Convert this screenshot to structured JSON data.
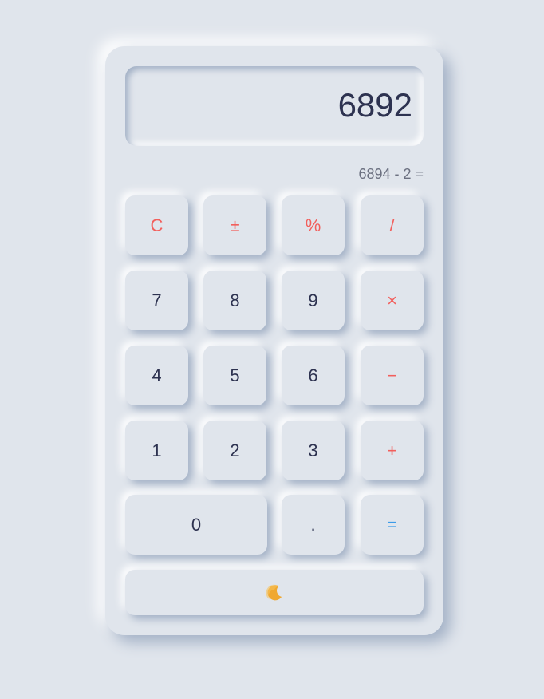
{
  "display": {
    "value": "6892",
    "expression": "6894 - 2 ="
  },
  "keys": {
    "clear": "C",
    "sign": "±",
    "percent": "%",
    "divide": "/",
    "seven": "7",
    "eight": "8",
    "nine": "9",
    "multiply": "×",
    "four": "4",
    "five": "5",
    "six": "6",
    "subtract": "−",
    "one": "1",
    "two": "2",
    "three": "3",
    "add": "+",
    "zero": "0",
    "decimal": ".",
    "equals": "="
  },
  "theme_toggle": {
    "icon": "moon-icon"
  },
  "colors": {
    "background": "#e0e5ec",
    "text": "#2d3250",
    "operator": "#f25f5c",
    "equals": "#3b9be8",
    "expression": "#6b7080",
    "moon": "#f0a830"
  }
}
